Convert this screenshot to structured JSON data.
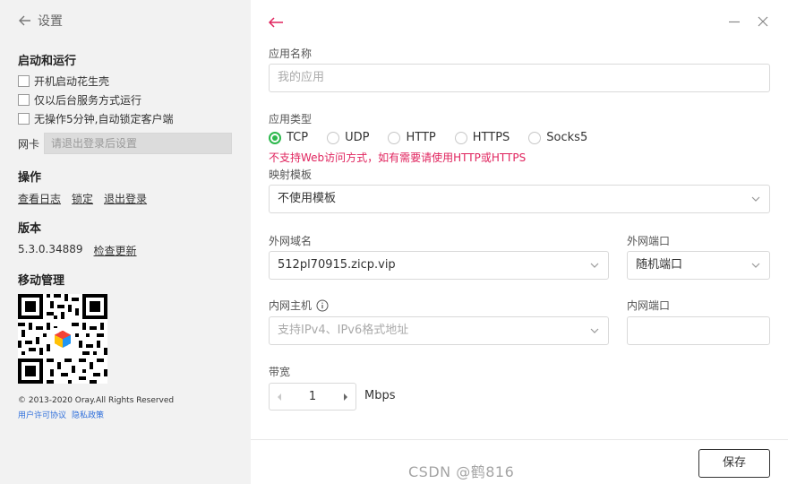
{
  "sidebar": {
    "title": "设置",
    "startup_section": "启动和运行",
    "startup_options": [
      "开机启动花生壳",
      "仅以后台服务方式运行",
      "无操作5分钟,自动锁定客户端"
    ],
    "nic_label": "网卡",
    "nic_placeholder": "请退出登录后设置",
    "operations_section": "操作",
    "operations": [
      "查看日志",
      "锁定",
      "退出登录"
    ],
    "version_section": "版本",
    "version": "5.3.0.34889",
    "check_update": "检查更新",
    "mobile_section": "移动管理",
    "copyright": "© 2013-2020 Oray.All Rights Reserved",
    "license_link": "用户许可协议",
    "privacy_link": "隐私政策"
  },
  "form": {
    "app_name_label": "应用名称",
    "app_name_placeholder": "我的应用",
    "app_type_label": "应用类型",
    "app_types": [
      "TCP",
      "UDP",
      "HTTP",
      "HTTPS",
      "Socks5"
    ],
    "selected_type": "TCP",
    "type_warning": "不支持Web访问方式，如有需要请使用HTTP或HTTPS",
    "template_label": "映射模板",
    "template_value": "不使用模板",
    "domain_label": "外网域名",
    "domain_value": "512pl70915.zicp.vip",
    "ext_port_label": "外网端口",
    "ext_port_value": "随机端口",
    "int_host_label": "内网主机",
    "int_host_placeholder": "支持IPv4、IPv6格式地址",
    "int_port_label": "内网端口",
    "int_port_value": "",
    "bandwidth_label": "带宽",
    "bandwidth_value": "1",
    "bandwidth_unit": "Mbps",
    "save_label": "保存"
  },
  "watermark": "CSDN @鹤816",
  "colors": {
    "accent_green": "#2db84d",
    "warning_red": "#e0245e",
    "back_arrow": "#e0245e",
    "link_blue": "#2f6fdb"
  }
}
